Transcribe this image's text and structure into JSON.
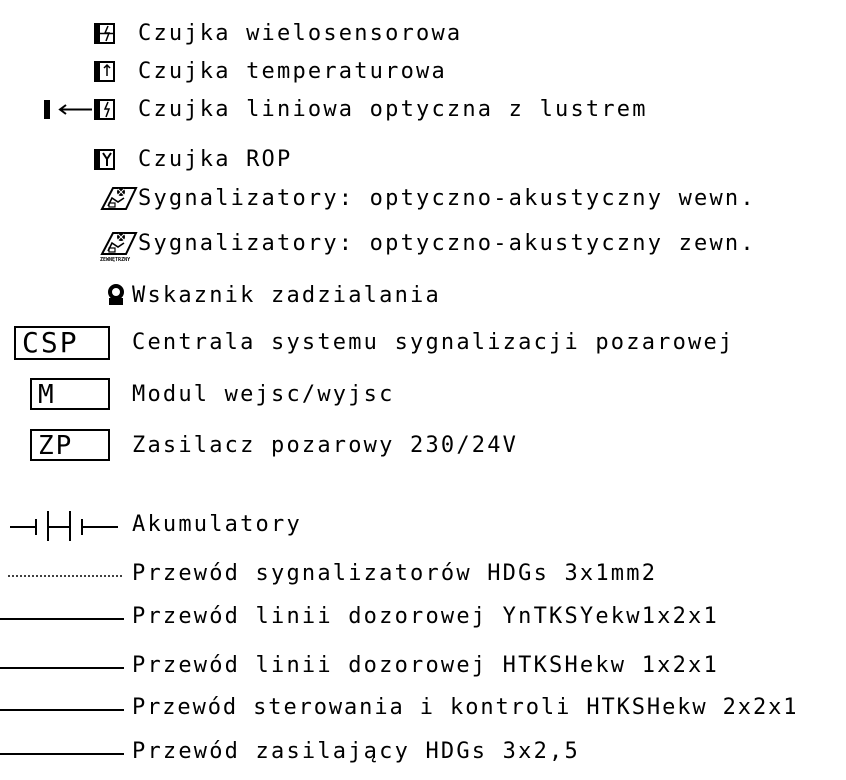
{
  "legend": {
    "items": [
      {
        "symbol": "multisensor-detector-icon",
        "label": "Czujka wielosensorowa"
      },
      {
        "symbol": "temperature-detector-icon",
        "label": "Czujka temperaturowa"
      },
      {
        "symbol": "linear-beam-detector-icon",
        "label": "Czujka liniowa optyczna z lustrem"
      },
      {
        "symbol": "manual-call-point-icon",
        "label": "Czujka ROP"
      },
      {
        "symbol": "sounder-beacon-indoor-icon",
        "label": "Sygnalizatory: optyczno-akustyczny wewn."
      },
      {
        "symbol": "sounder-beacon-outdoor-icon",
        "label": "Sygnalizatory: optyczno-akustyczny zewn.",
        "symbol_text": "ZEWNĘTRZNY"
      },
      {
        "symbol": "action-indicator-icon",
        "label": "Wskaznik zadzialania"
      },
      {
        "symbol": "box",
        "box_text": "CSP",
        "label": "Centrala systemu sygnalizacji pozarowej"
      },
      {
        "symbol": "box",
        "box_text": "M",
        "label": "Modul wejsc/wyjsc"
      },
      {
        "symbol": "box",
        "box_text": "ZP",
        "label": "Zasilacz pozarowy 230/24V"
      },
      {
        "symbol": "battery-icon",
        "label": "Akumulatory"
      },
      {
        "symbol": "dashed-line",
        "label": "Przewód sygnalizatorów HDGs 3x1mm2"
      },
      {
        "symbol": "solid-line",
        "label": "Przewód linii dozorowej YnTKSYekw1x2x1"
      },
      {
        "symbol": "solid-line",
        "label": "Przewód linii dozorowej HTKSHekw 1x2x1"
      },
      {
        "symbol": "solid-line",
        "label": "Przewód sterowania i kontroli HTKSHekw 2x2x1"
      },
      {
        "symbol": "solid-line",
        "label": "Przewód zasilający HDGs 3x2,5"
      }
    ]
  }
}
